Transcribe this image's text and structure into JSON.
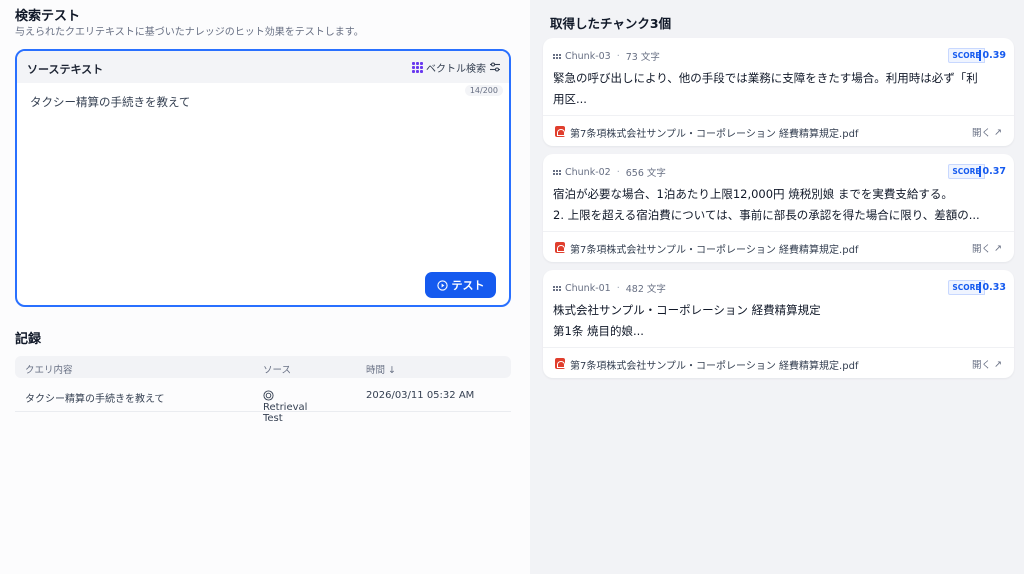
{
  "header": {
    "title": "検索テスト",
    "subtitle": "与えられたクエリテキストに基づいたナレッジのヒット効果をテストします。"
  },
  "source": {
    "label": "ソーステキスト",
    "method_label": "ベクトル検索",
    "char_count": "14/200",
    "query": "タクシー精算の手続きを教えて",
    "test_button": "テスト"
  },
  "records": {
    "title": "記録",
    "columns": [
      "クエリ内容",
      "ソース",
      "時間 ↓"
    ],
    "rows": [
      {
        "query": "タクシー精算の手続きを教えて",
        "source": "Retrieval Test",
        "time": "2026/03/11 05:32 AM"
      }
    ]
  },
  "chunks": {
    "title": "取得したチャンク3個",
    "score_label": "SCORE",
    "open_label": "開く",
    "items": [
      {
        "id": "Chunk-03",
        "chars": "73 文字",
        "score": "0.39",
        "line1": "緊急の呼び出しにより、他の手段では業務に支障をきたす場合。利用時は必ず「利",
        "line2": "用区...",
        "doc": "第7条項株式会社サンプル・コーポレーション 経費精算規定.pdf"
      },
      {
        "id": "Chunk-02",
        "chars": "656 文字",
        "score": "0.37",
        "line1": "宿泊が必要な場合、1泊あたり上限12,000円 焼税別娘 までを実費支給する。",
        "line2": "2. 上限を超える宿泊費については、事前に部長の承認を得た場合に限り、差額の...",
        "doc": "第7条項株式会社サンプル・コーポレーション 経費精算規定.pdf"
      },
      {
        "id": "Chunk-01",
        "chars": "482 文字",
        "score": "0.33",
        "line1": "株式会社サンプル・コーポレーション 経費精算規定",
        "line2": "第1条 焼目的娘...",
        "doc": "第7条項株式会社サンプル・コーポレーション 経費精算規定.pdf"
      }
    ]
  }
}
